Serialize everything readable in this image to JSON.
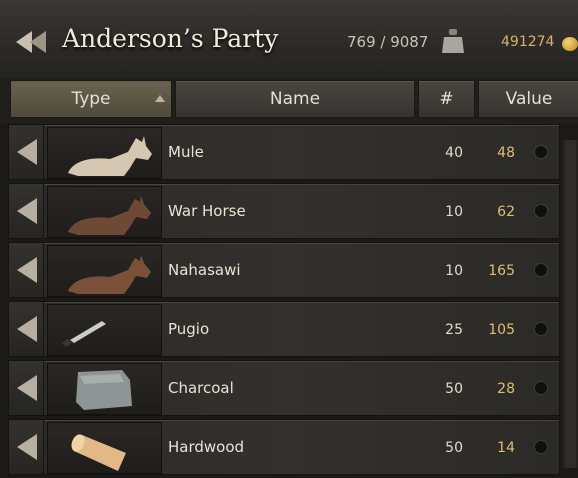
{
  "header": {
    "title": "Anderson’s Party",
    "weight": "769 / 9087",
    "gold": "491274",
    "icons": {
      "back": "double-left-arrow-icon",
      "weight": "weight-icon",
      "gold": "gold-coin-icon"
    }
  },
  "columns": {
    "type": "Type",
    "name": "Name",
    "count": "#",
    "value": "Value"
  },
  "sort": {
    "column": "type",
    "direction": "ascending"
  },
  "items": [
    {
      "name": "Mule",
      "count": "40",
      "value": "48",
      "icon": "mule-icon"
    },
    {
      "name": "War Horse",
      "count": "10",
      "value": "62",
      "icon": "horse-icon"
    },
    {
      "name": "Nahasawi",
      "count": "10",
      "value": "165",
      "icon": "horse-icon"
    },
    {
      "name": "Pugio",
      "count": "25",
      "value": "105",
      "icon": "dagger-icon"
    },
    {
      "name": "Charcoal",
      "count": "50",
      "value": "28",
      "icon": "charcoal-sack-icon"
    },
    {
      "name": "Hardwood",
      "count": "50",
      "value": "14",
      "icon": "hardwood-log-icon"
    }
  ],
  "colors": {
    "accent_gold": "#e0bd6f",
    "title_text": "#f2eadb",
    "background": "#1b1a18"
  }
}
